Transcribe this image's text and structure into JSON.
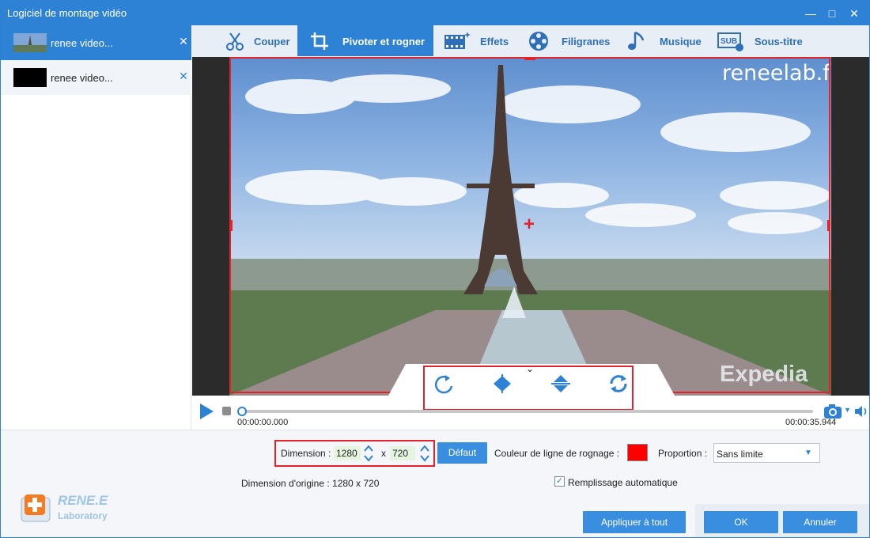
{
  "window": {
    "title": "Logiciel de montage vidéo",
    "controls": [
      "minimize-icon",
      "maximize-icon",
      "close-icon"
    ]
  },
  "sidebar": {
    "items": [
      {
        "name": "renee video...",
        "active": true
      },
      {
        "name": "renee video...",
        "active": false
      }
    ]
  },
  "tabs": [
    {
      "label": "Couper",
      "icon": "scissors-icon",
      "active": false
    },
    {
      "label": "Pivoter et rogner",
      "icon": "crop-rotate-icon",
      "active": true
    },
    {
      "label": "Effets",
      "icon": "film-effects-icon",
      "active": false
    },
    {
      "label": "Filigranes",
      "icon": "film-reel-icon",
      "active": false
    },
    {
      "label": "Musique",
      "icon": "music-note-icon",
      "active": false
    },
    {
      "label": "Sous-titre",
      "icon": "subtitle-icon",
      "active": false
    }
  ],
  "preview": {
    "watermark_top": "reneelab.fr",
    "watermark_bottom": "Expedia"
  },
  "rotate_controls": [
    "rotate-clockwise-icon",
    "flip-horizontal-icon",
    "flip-vertical-icon",
    "rotate-reset-icon"
  ],
  "timeline": {
    "current_time": "00:00:00.000",
    "total_time": "00:00:35.944"
  },
  "settings": {
    "dimension_label": "Dimension :",
    "width": "1280",
    "separator": "x",
    "height": "720",
    "default_button": "Défaut",
    "crop_color_label": "Couleur de ligne de rognage :",
    "crop_color": "#ff0000",
    "proportion_label": "Proportion :",
    "proportion_value": "Sans limite",
    "original_dimension": "Dimension d'origine : 1280 x 720",
    "auto_fill_label": "Remplissage automatique",
    "auto_fill_checked": true
  },
  "footer": {
    "apply_all": "Appliquer à tout",
    "ok": "OK",
    "cancel": "Annuler"
  },
  "brand": {
    "name": "RENE.E",
    "sub": "Laboratory"
  },
  "colors": {
    "accent": "#2e82d6",
    "crop_border": "#e3222c"
  }
}
